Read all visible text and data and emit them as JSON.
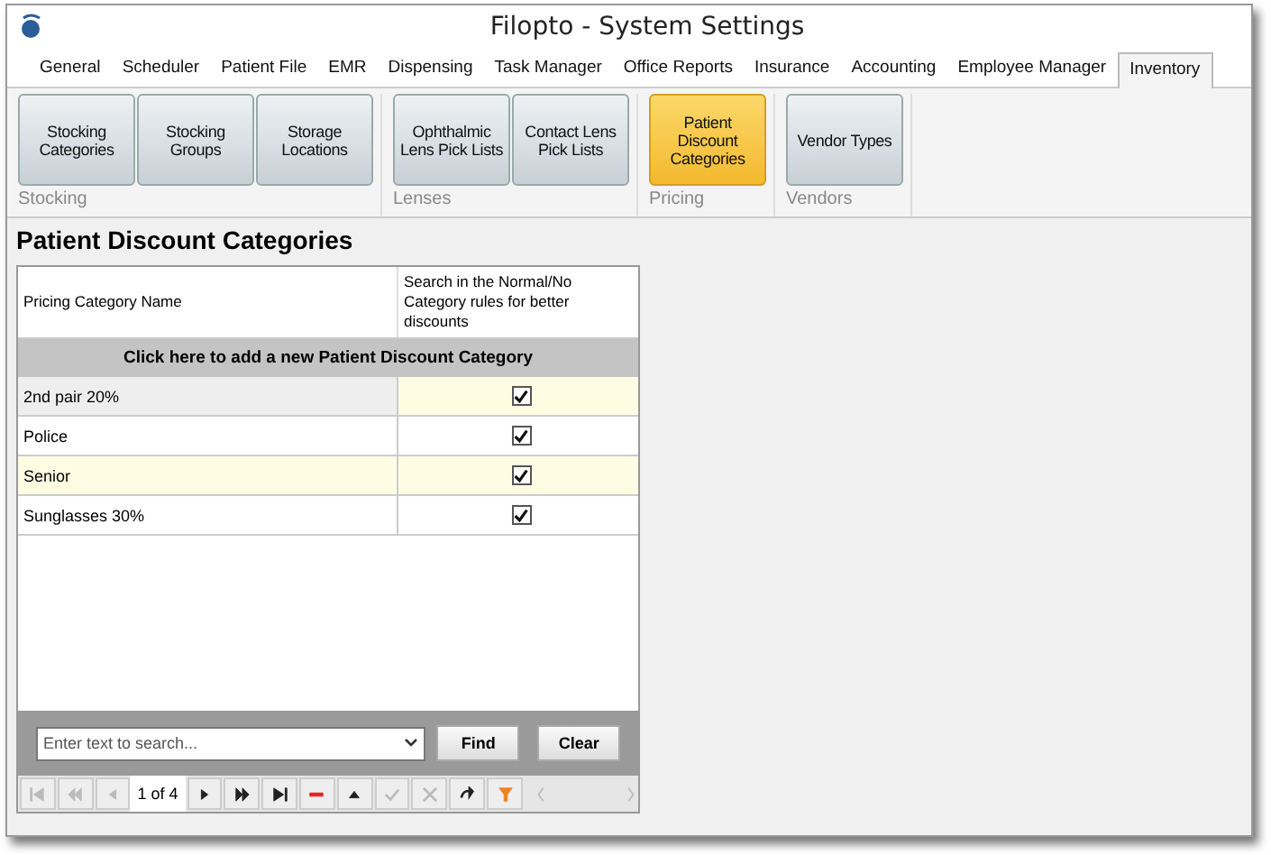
{
  "window": {
    "title": "Filopto - System Settings"
  },
  "tabs": [
    {
      "label": "General",
      "selected": false
    },
    {
      "label": "Scheduler",
      "selected": false
    },
    {
      "label": "Patient File",
      "selected": false
    },
    {
      "label": "EMR",
      "selected": false
    },
    {
      "label": "Dispensing",
      "selected": false
    },
    {
      "label": "Task Manager",
      "selected": false
    },
    {
      "label": "Office Reports",
      "selected": false
    },
    {
      "label": "Insurance",
      "selected": false
    },
    {
      "label": "Accounting",
      "selected": false
    },
    {
      "label": "Employee Manager",
      "selected": false
    },
    {
      "label": "Inventory",
      "selected": true
    }
  ],
  "ribbon_groups": [
    {
      "label": "Stocking",
      "buttons": [
        {
          "label": "Stocking Categories",
          "selected": false
        },
        {
          "label": "Stocking Groups",
          "selected": false
        },
        {
          "label": "Storage Locations",
          "selected": false
        }
      ]
    },
    {
      "label": "Lenses",
      "buttons": [
        {
          "label": "Ophthalmic Lens Pick Lists",
          "selected": false
        },
        {
          "label": "Contact Lens Pick Lists",
          "selected": false
        }
      ]
    },
    {
      "label": "Pricing",
      "buttons": [
        {
          "label": "Patient Discount Categories",
          "selected": true
        }
      ]
    },
    {
      "label": "Vendors",
      "buttons": [
        {
          "label": "Vendor Types",
          "selected": false
        }
      ]
    }
  ],
  "page_title": "Patient Discount Categories",
  "table": {
    "columns": [
      "Pricing Category Name",
      "Search in the Normal/No Category rules for better discounts"
    ],
    "add_row": "Click here to add a new Patient Discount Category",
    "rows": [
      {
        "name": "2nd pair 20%",
        "checked": true,
        "selected": true
      },
      {
        "name": "Police",
        "checked": true,
        "selected": false
      },
      {
        "name": "Senior",
        "checked": true,
        "selected": false
      },
      {
        "name": "Sunglasses 30%",
        "checked": true,
        "selected": false
      }
    ]
  },
  "search": {
    "placeholder": "Enter text to search...",
    "find": "Find",
    "clear": "Clear"
  },
  "pager": {
    "position": "1 of 4",
    "buttons": [
      {
        "kind": "first",
        "disabled": true
      },
      {
        "kind": "prev-page",
        "disabled": true
      },
      {
        "kind": "prev",
        "disabled": true
      },
      {
        "kind": "position"
      },
      {
        "kind": "next",
        "disabled": false
      },
      {
        "kind": "next-page",
        "disabled": false
      },
      {
        "kind": "last",
        "disabled": false
      },
      {
        "kind": "delete",
        "disabled": false
      },
      {
        "kind": "up",
        "disabled": false
      },
      {
        "kind": "accept",
        "disabled": true
      },
      {
        "kind": "cancel",
        "disabled": true
      },
      {
        "kind": "refresh",
        "disabled": false
      },
      {
        "kind": "filter",
        "disabled": false
      },
      {
        "kind": "scroll-left",
        "disabled": true
      },
      {
        "kind": "scroll-right",
        "disabled": true
      }
    ]
  }
}
